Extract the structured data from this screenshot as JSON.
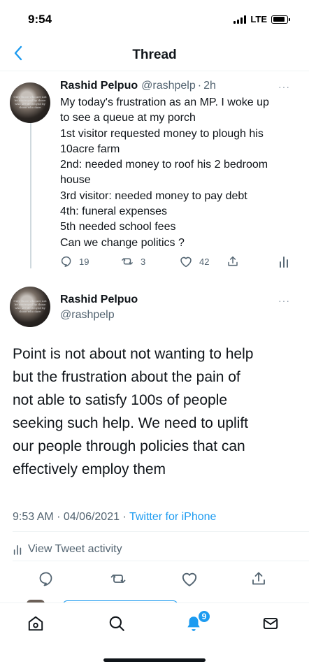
{
  "status_bar": {
    "time": "9:54",
    "network": "LTE",
    "battery_level": 0.85
  },
  "header": {
    "title": "Thread",
    "back_icon": "chevron-left-icon"
  },
  "avatar_caption": "Only those who are not be destroyed by those who are destroyed by those who dare",
  "parent_tweet": {
    "author_name": "Rashid Pelpuo",
    "author_handle": "@rashpelp",
    "separator": "·",
    "time": "2h",
    "more": "···",
    "lines": [
      "My today's frustration as an MP. I woke up",
      "to see a queue at my porch",
      "1st visitor requested money to plough his",
      "10acre farm",
      "2nd: needed money to roof his 2 bedroom",
      "house",
      "3rd visitor: needed money to pay debt",
      "4th: funeral expenses",
      "5th needed school fees",
      "Can we change politics ?"
    ],
    "replies": "19",
    "retweets": "3",
    "likes": "42"
  },
  "main_tweet": {
    "author_name": "Rashid Pelpuo",
    "author_handle": "@rashpelp",
    "more": "···",
    "lines": [
      "Point is not about not wanting to help",
      "but the frustration about the pain of",
      "not able to satisfy 100s of people",
      "seeking such help. We need to uplift",
      "our people through policies that can",
      "effectively employ them"
    ],
    "timestamp": "9:53 AM · 04/06/2021 · ",
    "source": "Twitter for iPhone",
    "activity_label": "View Tweet activity"
  },
  "bottom_nav": {
    "notifications_badge": "9"
  },
  "colors": {
    "accent": "#1d9bf0",
    "text": "#0f1419",
    "muted": "#536471",
    "divider": "#eff3f4"
  }
}
